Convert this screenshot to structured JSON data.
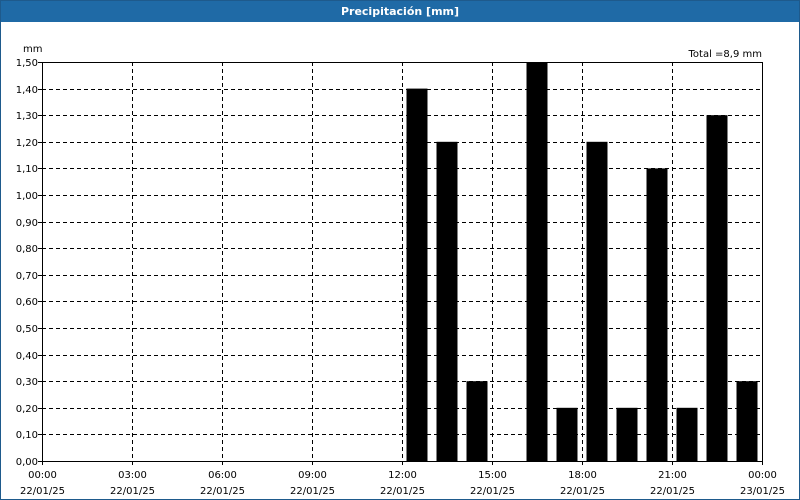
{
  "window": {
    "title": "Precipitación [mm]"
  },
  "chart_data": {
    "type": "bar",
    "title": "Precipitación [mm]",
    "total_label": "Total =8,9 mm",
    "ylabel": "mm",
    "ylim": [
      0,
      1.5
    ],
    "y_ticks": [
      "0,00",
      "0,10",
      "0,20",
      "0,30",
      "0,40",
      "0,50",
      "0,60",
      "0,70",
      "0,80",
      "0,90",
      "1,00",
      "1,10",
      "1,20",
      "1,30",
      "1,40",
      "1,50"
    ],
    "x_ticks": [
      {
        "time": "00:00",
        "date": "22/01/25"
      },
      {
        "time": "03:00",
        "date": "22/01/25"
      },
      {
        "time": "06:00",
        "date": "22/01/25"
      },
      {
        "time": "09:00",
        "date": "22/01/25"
      },
      {
        "time": "12:00",
        "date": "22/01/25"
      },
      {
        "time": "15:00",
        "date": "22/01/25"
      },
      {
        "time": "18:00",
        "date": "22/01/25"
      },
      {
        "time": "21:00",
        "date": "22/01/25"
      },
      {
        "time": "00:00",
        "date": "23/01/25"
      }
    ],
    "xlim": [
      "22/01/25 00:00",
      "23/01/25 00:00"
    ],
    "bars": [
      {
        "start": "22/01/25 12:00",
        "value": 1.4
      },
      {
        "start": "22/01/25 13:00",
        "value": 1.2
      },
      {
        "start": "22/01/25 14:00",
        "value": 0.3
      },
      {
        "start": "22/01/25 16:00",
        "value": 1.5
      },
      {
        "start": "22/01/25 17:00",
        "value": 0.2
      },
      {
        "start": "22/01/25 18:00",
        "value": 1.2
      },
      {
        "start": "22/01/25 19:00",
        "value": 0.2
      },
      {
        "start": "22/01/25 20:00",
        "value": 1.1
      },
      {
        "start": "22/01/25 21:00",
        "value": 0.2
      },
      {
        "start": "22/01/25 22:00",
        "value": 1.3
      },
      {
        "start": "22/01/25 23:00",
        "value": 0.3
      }
    ],
    "grid": true,
    "bar_color": "#000000",
    "title_bar_color": "#1f6aa6"
  }
}
